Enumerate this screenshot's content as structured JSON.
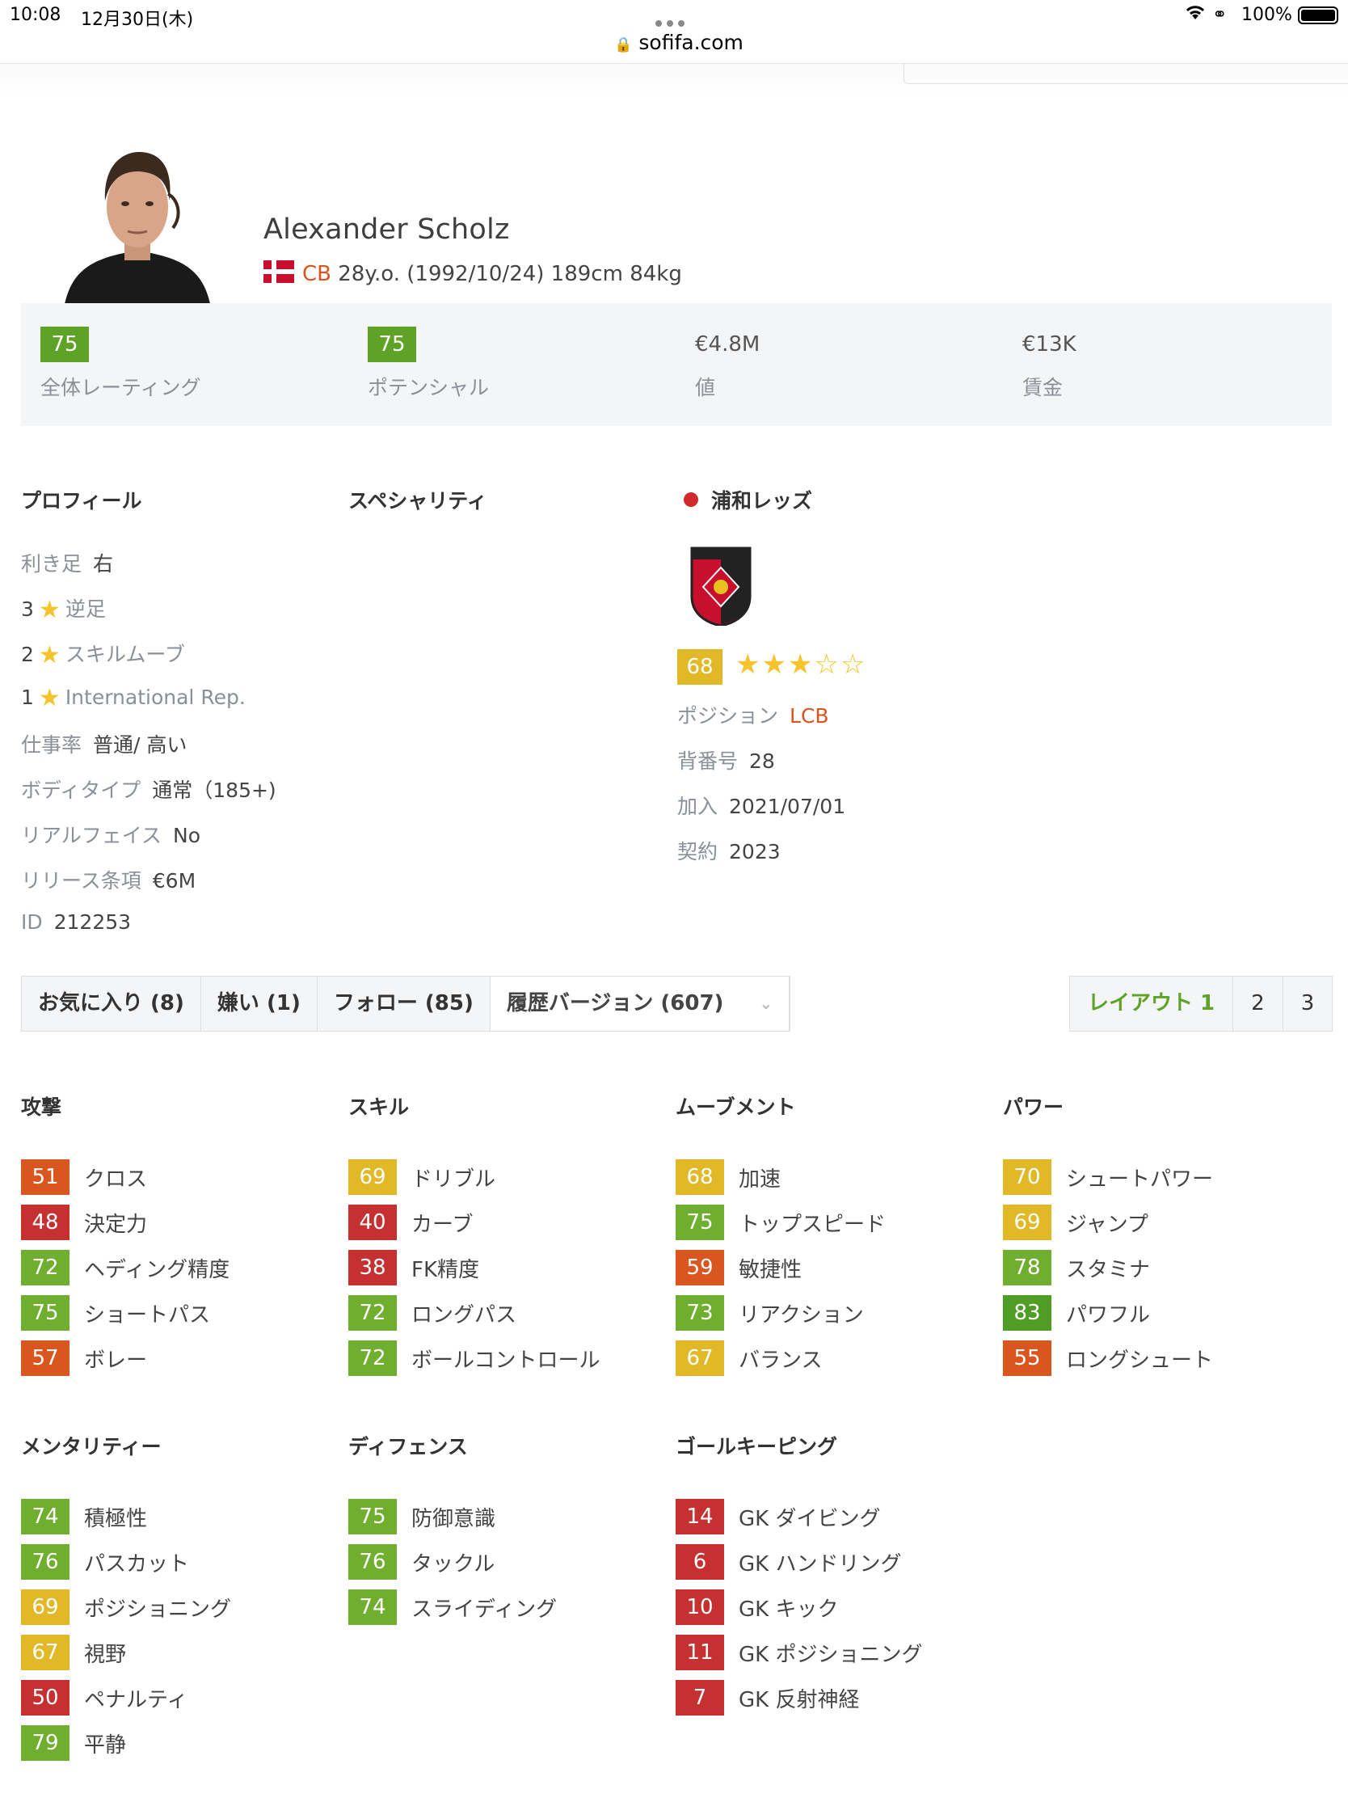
{
  "status_bar": {
    "time": "10:08",
    "date": "12月30日(木)",
    "battery": "100%"
  },
  "browser": {
    "url": "sofifa.com"
  },
  "player": {
    "name": "Alexander Scholz",
    "position": "CB",
    "meta": "28y.o. (1992/10/24) 189cm 84kg"
  },
  "summary": [
    {
      "value": "75",
      "label": "全体レーティング",
      "badge": true
    },
    {
      "value": "75",
      "label": "ポテンシャル",
      "badge": true
    },
    {
      "value": "€4.8M",
      "label": "値",
      "badge": false
    },
    {
      "value": "€13K",
      "label": "賃金",
      "badge": false
    }
  ],
  "profile": {
    "heading": "プロフィール",
    "preferred_foot_label": "利き足",
    "preferred_foot": "右",
    "weak_foot_value": "3",
    "weak_foot_label": "逆足",
    "skill_moves_value": "2",
    "skill_moves_label": "スキルムーブ",
    "intl_rep_value": "1",
    "intl_rep_label": "International Rep.",
    "work_rate_label": "仕事率",
    "work_rate": "普通/ 高い",
    "body_type_label": "ボディタイプ",
    "body_type": "通常（185+)",
    "real_face_label": "リアルフェイス",
    "real_face": "No",
    "release_clause_label": "リリース条項",
    "release_clause": "€6M",
    "id_label": "ID",
    "id": "212253"
  },
  "specialities": {
    "heading": "スペシャリティ"
  },
  "club": {
    "name": "浦和レッズ",
    "rating": "68",
    "stars_rating": 2.5,
    "position_label": "ポジション",
    "position": "LCB",
    "jersey_label": "背番号",
    "jersey": "28",
    "joined_label": "加入",
    "joined": "2021/07/01",
    "contract_label": "契約",
    "contract": "2023"
  },
  "actions": {
    "like": "お気に入り (8)",
    "dislike": "嫌い (1)",
    "follow": "フォロー (85)",
    "history": "履歴バージョン (607)"
  },
  "layout_tabs": [
    "レイアウト 1",
    "2",
    "3"
  ],
  "colors": {
    "dark_green": "#4f9d25",
    "green": "#6fae2f",
    "yellow": "#e0b828",
    "orange": "#d9571f",
    "red": "#c53030"
  },
  "attributes": [
    {
      "heading": "攻撃",
      "items": [
        {
          "v": "51",
          "n": "クロス",
          "c": "o"
        },
        {
          "v": "48",
          "n": "決定力",
          "c": "r"
        },
        {
          "v": "72",
          "n": "ヘディング精度",
          "c": "g"
        },
        {
          "v": "75",
          "n": "ショートパス",
          "c": "g"
        },
        {
          "v": "57",
          "n": "ボレー",
          "c": "o"
        }
      ]
    },
    {
      "heading": "スキル",
      "items": [
        {
          "v": "69",
          "n": "ドリブル",
          "c": "y"
        },
        {
          "v": "40",
          "n": "カーブ",
          "c": "r"
        },
        {
          "v": "38",
          "n": "FK精度",
          "c": "r"
        },
        {
          "v": "72",
          "n": "ロングパス",
          "c": "g"
        },
        {
          "v": "72",
          "n": "ボールコントロール",
          "c": "g"
        }
      ]
    },
    {
      "heading": "ムーブメント",
      "items": [
        {
          "v": "68",
          "n": "加速",
          "c": "y"
        },
        {
          "v": "75",
          "n": "トップスピード",
          "c": "g"
        },
        {
          "v": "59",
          "n": "敏捷性",
          "c": "o"
        },
        {
          "v": "73",
          "n": "リアクション",
          "c": "g"
        },
        {
          "v": "67",
          "n": "バランス",
          "c": "y"
        }
      ]
    },
    {
      "heading": "パワー",
      "items": [
        {
          "v": "70",
          "n": "シュートパワー",
          "c": "y"
        },
        {
          "v": "69",
          "n": "ジャンプ",
          "c": "y"
        },
        {
          "v": "78",
          "n": "スタミナ",
          "c": "g"
        },
        {
          "v": "83",
          "n": "パワフル",
          "c": "dg"
        },
        {
          "v": "55",
          "n": "ロングシュート",
          "c": "o"
        }
      ]
    },
    {
      "heading": "メンタリティー",
      "items": [
        {
          "v": "74",
          "n": "積極性",
          "c": "g"
        },
        {
          "v": "76",
          "n": "パスカット",
          "c": "g"
        },
        {
          "v": "69",
          "n": "ポジショニング",
          "c": "y"
        },
        {
          "v": "67",
          "n": "視野",
          "c": "y"
        },
        {
          "v": "50",
          "n": "ペナルティ",
          "c": "r"
        },
        {
          "v": "79",
          "n": "平静",
          "c": "g"
        }
      ]
    },
    {
      "heading": "ディフェンス",
      "items": [
        {
          "v": "75",
          "n": "防御意識",
          "c": "g"
        },
        {
          "v": "76",
          "n": "タックル",
          "c": "g"
        },
        {
          "v": "74",
          "n": "スライディング",
          "c": "g"
        }
      ]
    },
    {
      "heading": "ゴールキーピング",
      "items": [
        {
          "v": "14",
          "n": "GK ダイビング",
          "c": "r"
        },
        {
          "v": "6",
          "n": "GK ハンドリング",
          "c": "r"
        },
        {
          "v": "10",
          "n": "GK キック",
          "c": "r"
        },
        {
          "v": "11",
          "n": "GK ポジショニング",
          "c": "r"
        },
        {
          "v": "7",
          "n": "GK 反射神経",
          "c": "r"
        }
      ]
    }
  ]
}
